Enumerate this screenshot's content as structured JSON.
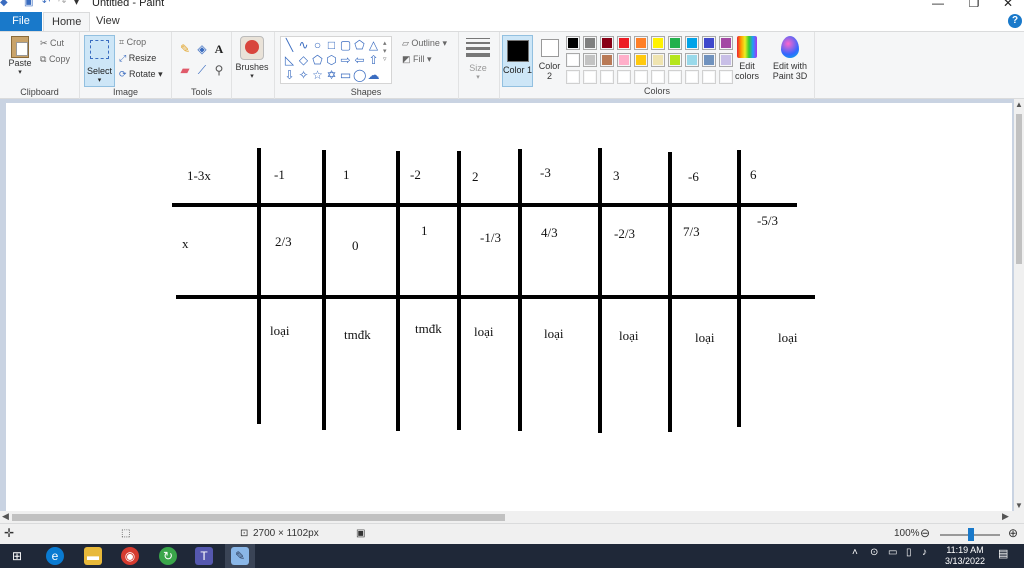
{
  "window": {
    "title": "Untitled - Paint",
    "minimize_glyph": "—",
    "maximize_glyph": "❐",
    "close_glyph": "✕"
  },
  "tabs": {
    "file": "File",
    "home": "Home",
    "view": "View",
    "help_glyph": "?"
  },
  "ribbon": {
    "clipboard": {
      "label": "Clipboard",
      "paste": "Paste",
      "cut": "Cut",
      "copy": "Copy"
    },
    "image": {
      "label": "Image",
      "select": "Select",
      "crop": "Crop",
      "resize": "Resize",
      "rotate": "Rotate"
    },
    "tools": {
      "label": "Tools"
    },
    "brushes": {
      "label": "Brushes"
    },
    "shapes": {
      "label": "Shapes",
      "outline": "Outline",
      "fill": "Fill"
    },
    "size": {
      "label": "Size"
    },
    "colors": {
      "label": "Colors",
      "color1": "Color 1",
      "color2": "Color 2",
      "edit_colors": "Edit colors",
      "paint3d": "Edit with Paint 3D",
      "color1_value": "#000000",
      "color2_value": "#ffffff",
      "palette_row1": [
        "#000000",
        "#7f7f7f",
        "#880015",
        "#ed1c24",
        "#ff7f27",
        "#fff200",
        "#22b14c",
        "#00a2e8",
        "#3f48cc",
        "#a349a4"
      ],
      "palette_row2": [
        "#ffffff",
        "#c3c3c3",
        "#b97a57",
        "#ffaec9",
        "#ffc90e",
        "#efe4b0",
        "#b5e61d",
        "#99d9ea",
        "#7092be",
        "#c8bfe7"
      ],
      "palette_row3": [
        "#ffffff",
        "#ffffff",
        "#ffffff",
        "#ffffff",
        "#ffffff",
        "#ffffff",
        "#ffffff",
        "#ffffff",
        "#ffffff",
        "#ffffff"
      ]
    }
  },
  "canvas": {
    "row1": [
      "1-3x",
      "-1",
      "1",
      "-2",
      "2",
      "-3",
      "3",
      "-6",
      "6"
    ],
    "row2": [
      "x",
      "2/3",
      "0",
      "1",
      "-1/3",
      "4/3",
      "-2/3",
      "7/3",
      "-5/3"
    ],
    "row3": [
      "loại",
      "tmđk",
      "tmđk",
      "loại",
      "loại",
      "loại",
      "loại",
      "loại"
    ]
  },
  "status": {
    "image_size": "2700 × 1102px",
    "zoom": "100%"
  },
  "taskbar": {
    "time": "11:19 AM",
    "date": "3/13/2022"
  }
}
